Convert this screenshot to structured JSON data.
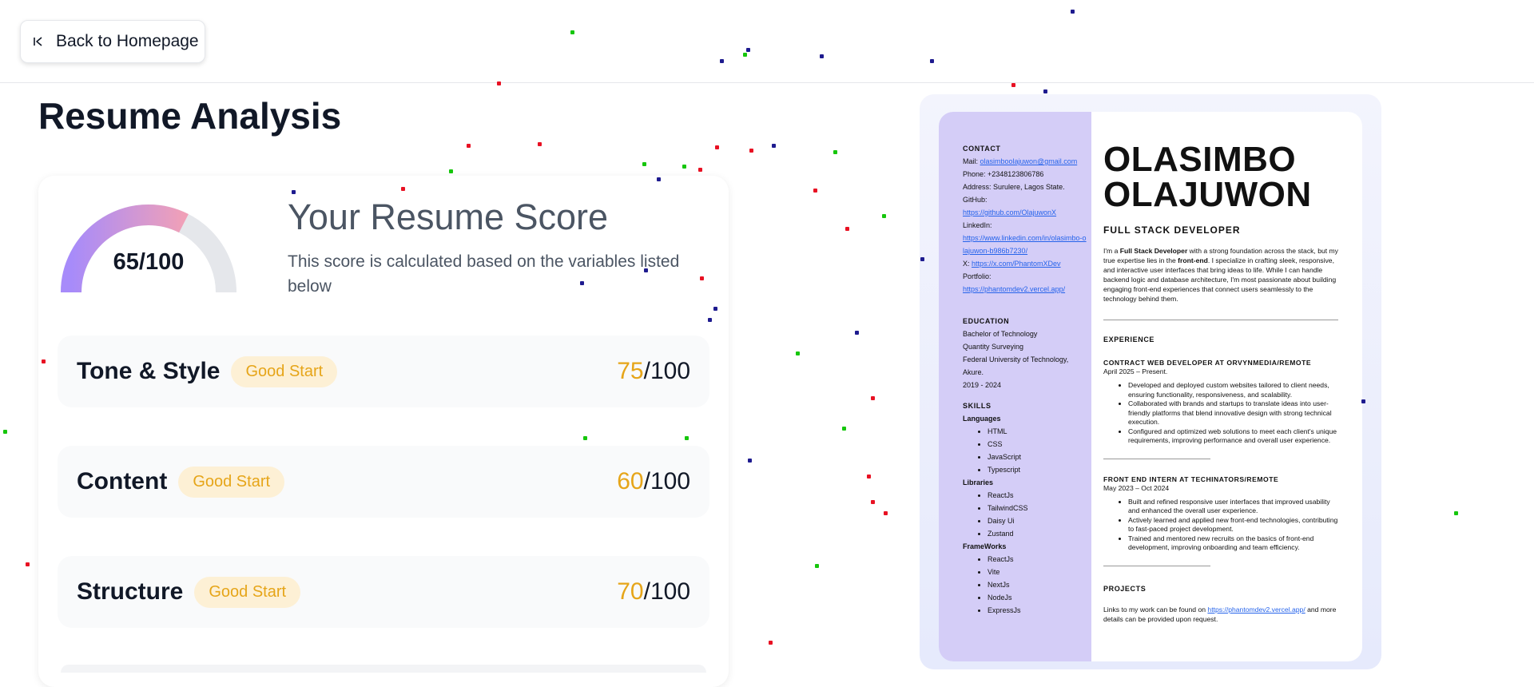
{
  "nav": {
    "back_label": "Back to Homepage"
  },
  "page": {
    "title": "Resume Analysis"
  },
  "score": {
    "overall": 65,
    "max": 100,
    "label": "65/100",
    "title": "Your Resume Score",
    "description": "This score is calculated based on the variables listed below"
  },
  "categories": [
    {
      "name": "Tone & Style",
      "badge": "Good Start",
      "score": "75",
      "max": "/100"
    },
    {
      "name": "Content",
      "badge": "Good Start",
      "score": "60",
      "max": "/100"
    },
    {
      "name": "Structure",
      "badge": "Good Start",
      "score": "70",
      "max": "/100"
    }
  ],
  "colors": {
    "badge_text": "#e6a519",
    "badge_bg": "#fdf0d5",
    "gauge_start": "#a78bfa",
    "gauge_end": "#f0a0b8",
    "sidebar_bg": "#d4cdf7"
  },
  "resume": {
    "contact": {
      "heading": "CONTACT",
      "mail_label": "Mail: ",
      "mail": "olasimboolajuwon@gmail.com",
      "phone": "Phone: +2348123806786",
      "address": "Address: Surulere, Lagos State.",
      "github_label": "GitHub:",
      "github": "https://github.com/OlajuwonX",
      "linkedin_label": "LinkedIn:",
      "linkedin": "https://www.linkedin.com/in/olasimbo-olajuwon-b986b7230/",
      "x_label": "X: ",
      "x": "https://x.com/PhantomXDev",
      "portfolio_label": "Portfolio:",
      "portfolio": "https://phantomdev2.vercel.app/"
    },
    "education": {
      "heading": "EDUCATION",
      "degree": "Bachelor of Technology",
      "field": "Quantity Surveying",
      "school": "Federal University of Technology, Akure.",
      "years": "2019 - 2024"
    },
    "skills": {
      "heading": "SKILLS",
      "languages_label": "Languages",
      "languages": [
        "HTML",
        "CSS",
        "JavaScript",
        "Typescript"
      ],
      "libraries_label": "Libraries",
      "libraries": [
        "ReactJs",
        "TailwindCSS",
        "Daisy Ui",
        "Zustand"
      ],
      "frameworks_label": "FrameWorks",
      "frameworks": [
        "ReactJs",
        "Vite",
        "NextJs",
        "NodeJs",
        "ExpressJs"
      ]
    },
    "name_first": "OLASIMBO",
    "name_last": "OLAJUWON",
    "role": "FULL STACK DEVELOPER",
    "summary": {
      "p1": "I'm a ",
      "b1": "Full Stack Developer",
      "p2": " with a strong foundation across the stack, but my true expertise lies in the ",
      "b2": "front-end",
      "p3": ". I specialize in crafting sleek, responsive, and interactive user interfaces that bring ideas to life. While I can handle backend logic and database architecture, I'm most passionate about building engaging front-end experiences that connect users seamlessly to the technology behind them."
    },
    "experience_heading": "EXPERIENCE",
    "jobs": [
      {
        "title": "CONTRACT WEB DEVELOPER AT ORVYNMEDIA/REMOTE",
        "date": "April 2025 – Present.",
        "bullets": [
          "Developed and deployed custom websites tailored to client needs, ensuring functionality, responsiveness, and scalability.",
          "Collaborated with brands and startups to translate ideas into user-friendly platforms that blend innovative design with strong technical execution.",
          "Configured and optimized web solutions to meet each client's unique requirements, improving performance and overall user experience."
        ]
      },
      {
        "title": "FRONT END INTERN AT TECHINATORS/REMOTE",
        "date": "May 2023 – Oct 2024",
        "bullets": [
          "Built and refined responsive user interfaces that improved usability and enhanced the overall user experience.",
          "Actively learned and applied new front-end technologies, contributing to fast-paced project development.",
          "Trained and mentored new recruits on the basics of front-end development, improving onboarding and team efficiency."
        ]
      }
    ],
    "projects": {
      "heading": "PROJECTS",
      "text_before": "Links to my work can be found on ",
      "link": "https://phantomdev2.vercel.app/",
      "text_after": " and more details can be provided upon request."
    }
  }
}
